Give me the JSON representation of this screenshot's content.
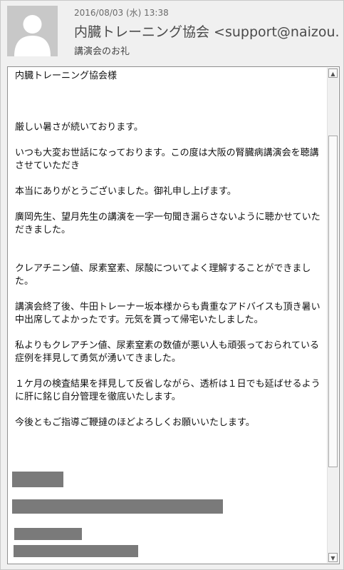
{
  "header": {
    "date": "2016/08/03 (水) 13:38",
    "from": "内臓トレーニング協会 <support@naizou.",
    "subject": "講演会のお礼"
  },
  "message": {
    "greeting": "内臓トレーニング協会様",
    "lines": [
      "厳しい暑さが続いております。",
      "いつも大変お世話になっております。この度は大阪の腎臓病講演会を聴講させていただき",
      "本当にありがとうございました。御礼申し上げます。",
      "廣岡先生、望月先生の講演を一字一句聞き漏らさないように聴かせていただきました。",
      "クレアチニン値、尿素窒素、尿酸についてよく理解することができました。",
      "講演会終了後、牛田トレーナー坂本様からも貴重なアドバイスも頂き暑い中出席してよかったです。元気を貰って帰宅いたしました。",
      "私よりもクレアチン値、尿素窒素の数値が悪い人も頑張っておられている症例を拝見して勇気が湧いてきました。",
      "１ケ月の検査結果を拝見して反省しながら、透析は１日でも延ばせるように肝に銘じ自分管理を徹底いたします。",
      "今後ともご指導ご鞭撻のほどよろしくお願いいたします。"
    ]
  },
  "icons": {
    "avatar": "default-user-avatar-icon",
    "scroll_up": "arrow-up-icon",
    "scroll_down": "arrow-down-icon"
  },
  "colors": {
    "redaction": "#7a7a7a",
    "avatar_bg": "#c8c8c8"
  }
}
